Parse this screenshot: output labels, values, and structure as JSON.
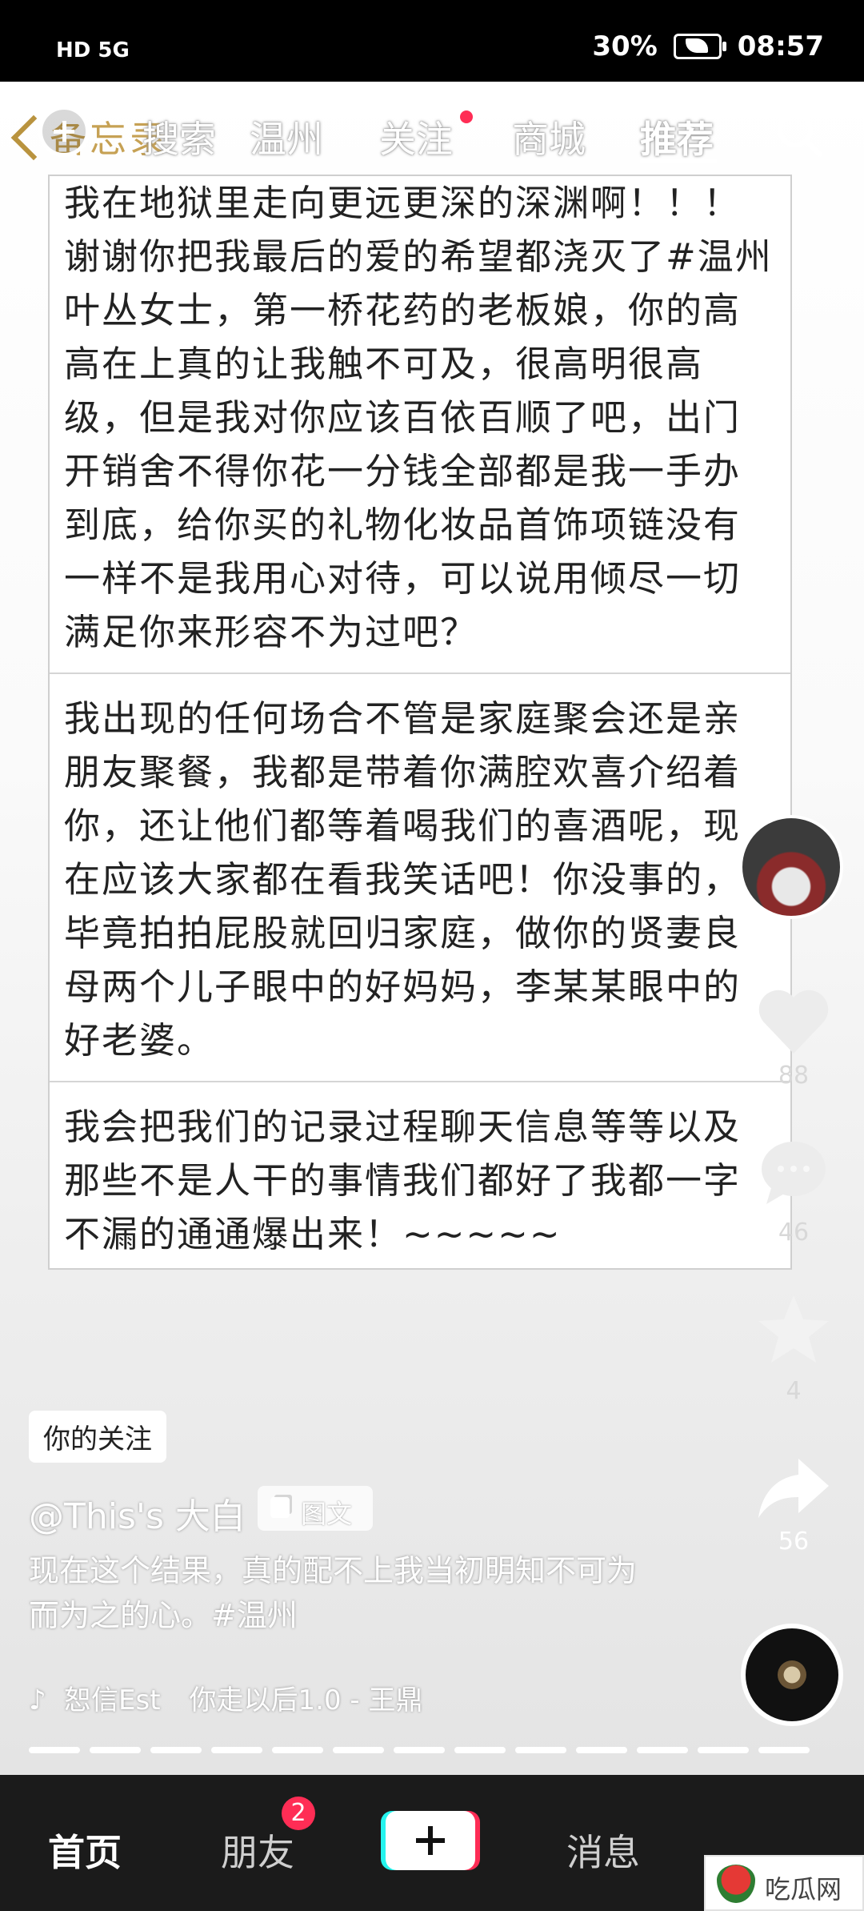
{
  "status_bar": {
    "left": "HD 5G",
    "battery": "30%",
    "time": "08:57"
  },
  "top_nav": {
    "memo_label": "备忘录",
    "tabs": [
      "搜索",
      "温州",
      "关注",
      "商城",
      "推荐"
    ],
    "active_tab": "推荐"
  },
  "note": {
    "blocks": [
      "我在地狱里走向更远更深的深渊啊！！！谢谢你把我最后的爱的希望都浇灭了#温州 叶丛女士，第一桥花药的老板娘，你的高高在上真的让我触不可及，很高明很高级，但是我对你应该百依百顺了吧，出门开销舍不得你花一分钱全部都是我一手办到底，给你买的礼物化妆品首饰项链没有一样不是我用心对待，可以说用倾尽一切满足你来形容不为过吧？",
      "我出现的任何场合不管是家庭聚会还是亲朋友聚餐，我都是带着你满腔欢喜介绍着你，还让他们都等着喝我们的喜酒呢，现在应该大家都在看我笑话吧！你没事的，毕竟拍拍屁股就回归家庭，做你的贤妻良母两个儿子眼中的好妈妈，李某某眼中的好老婆。",
      "我会把我们的记录过程聊天信息等等以及那些不是人干的事情我们都好了我都一字不漏的通通爆出来！~~~~~"
    ]
  },
  "side_actions": {
    "like_count": "88",
    "comment_count": "46",
    "favorite_count": "4",
    "share_count": "56"
  },
  "post": {
    "follow_tag": "你的关注",
    "author": "@This's 大白",
    "type_label": "图文",
    "description": "现在这个结果，真的配不上我当初明知不可为而为之的心。#温州",
    "music_artist": "恕信Est",
    "music_title": "你走以后1.0 - 王鼎"
  },
  "bottom_nav": {
    "home": "首页",
    "friends": "朋友",
    "friends_badge": "2",
    "messages": "消息"
  },
  "watermark": {
    "text": "吃瓜网"
  },
  "colors": {
    "accent_red": "#ff2d55",
    "memo_gold": "#c6a154",
    "bottom_bar": "#1b1b1b"
  }
}
